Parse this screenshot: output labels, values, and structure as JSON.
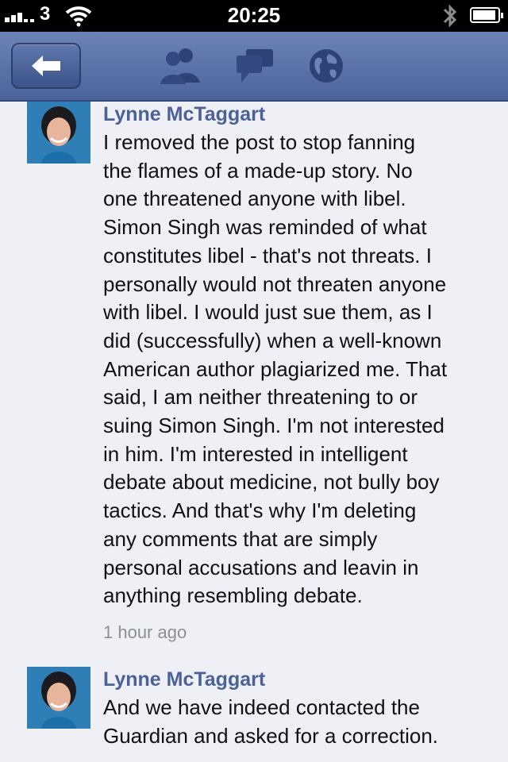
{
  "status_bar": {
    "carrier": "3",
    "time": "20:25"
  },
  "nav": {
    "icons": [
      "back-arrow-icon",
      "friends-icon",
      "messages-icon",
      "notifications-globe-icon"
    ]
  },
  "comments": [
    {
      "author": "Lynne McTaggart",
      "lines": [
        "I removed the post to stop fanning",
        "the flames of a made-up story. No",
        "one threatened anyone with libel.",
        "Simon Singh was reminded of what",
        "constitutes libel - that's not threats. I",
        "personally would not threaten anyone",
        "with libel. I would just sue them, as I",
        "did (successfully) when a well-known",
        "American author plagiarized me. That",
        "said, I am neither threatening to or",
        "suing Simon Singh. I'm not interested",
        "in him. I'm interested in intelligent",
        "debate about medicine, not bully boy",
        "tactics. And that's why I'm deleting",
        "any comments that are simply",
        "personal accusations and leavin in",
        "anything resembling debate."
      ],
      "time": "1 hour ago"
    },
    {
      "author": "Lynne McTaggart",
      "lines": [
        "And we have indeed contacted the",
        "Guardian and asked for a correction."
      ],
      "time": ""
    }
  ]
}
